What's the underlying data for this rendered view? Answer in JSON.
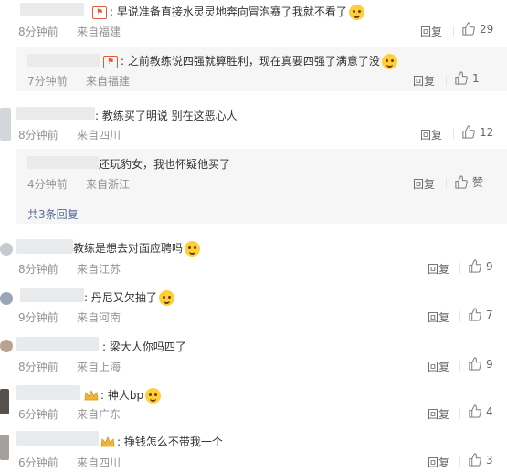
{
  "comments": [
    {
      "text": "早说准备直接水灵灵地奔向冒泡赛了我就不看了",
      "time": "8分钟前",
      "location": "来自福建",
      "reply": "回复",
      "likes": "29",
      "replies": [
        {
          "text": "之前教练说四强就算胜利，现在真要四强了满意了没",
          "time": "7分钟前",
          "location": "来自福建",
          "reply": "回复",
          "likes": "1"
        }
      ]
    },
    {
      "text": "教练买了明说 别在这恶心人",
      "time": "8分钟前",
      "location": "来自四川",
      "reply": "回复",
      "likes": "12",
      "replies": [
        {
          "text": "还玩豹女，我也怀疑他买了",
          "time": "4分钟前",
          "location": "来自浙江",
          "reply": "回复",
          "likes": "赞"
        }
      ],
      "more_replies": "共3条回复"
    },
    {
      "text": "教练是想去对面应聘吗",
      "time": "8分钟前",
      "location": "来自江苏",
      "reply": "回复",
      "likes": "9"
    },
    {
      "text": "丹尼又欠抽了",
      "time": "9分钟前",
      "location": "来自河南",
      "reply": "回复",
      "likes": "7"
    },
    {
      "text": "梁大人你吗四了",
      "time": "8分钟前",
      "location": "来自上海",
      "reply": "回复",
      "likes": "9"
    },
    {
      "text": "神人bp",
      "time": "6分钟前",
      "location": "来自广东",
      "reply": "回复",
      "likes": "4"
    },
    {
      "text": "挣钱怎么不带我一个",
      "time": "6分钟前",
      "location": "来自四川",
      "reply": "回复",
      "likes": "3"
    }
  ],
  "icons": {
    "like": "thumbs-up-icon",
    "badge": "fan-badge-icon",
    "emoji": "emoji-icon",
    "crown": "crown-icon"
  }
}
